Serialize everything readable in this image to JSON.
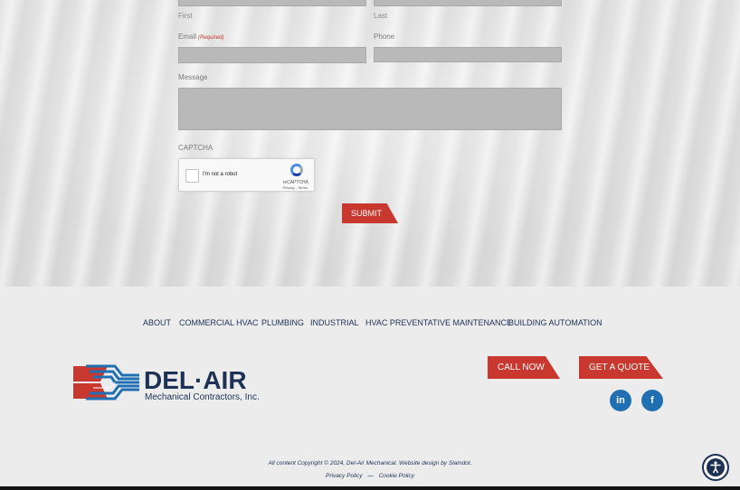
{
  "form": {
    "first_label": "First",
    "last_label": "Last",
    "email_label": "Email",
    "email_required": "(Required)",
    "phone_label": "Phone",
    "message_label": "Message",
    "captcha_label": "CAPTCHA",
    "captcha_text": "I'm not a robot",
    "captcha_brand": "reCAPTCHA",
    "captcha_terms": "Privacy - Terms",
    "submit_label": "SUBMIT"
  },
  "nav": {
    "items": [
      {
        "label": "ABOUT"
      },
      {
        "label": "COMMERCIAL HVAC"
      },
      {
        "label": "PLUMBING"
      },
      {
        "label": "INDUSTRIAL"
      },
      {
        "label": "HVAC PREVENTATIVE MAINTENANCE"
      },
      {
        "label": "BUILDING AUTOMATION"
      }
    ]
  },
  "brand": {
    "name": "DEL·AIR",
    "tagline": "Mechanical Contractors, Inc.",
    "colors": {
      "navy": "#1d3154",
      "red": "#c8382f",
      "blue": "#1f6fb2"
    }
  },
  "cta": {
    "call": "CALL NOW",
    "quote": "GET A QUOTE"
  },
  "social": {
    "linkedin": "in",
    "facebook": "f"
  },
  "footer": {
    "copyright_prefix": "All content Copyright © 2024, Del-Air Mechanical. Website design by ",
    "designer": "Slamdot",
    "copyright_suffix": ".",
    "privacy": "Privacy Policy",
    "separator": "—",
    "cookie": "Cookie Policy"
  }
}
